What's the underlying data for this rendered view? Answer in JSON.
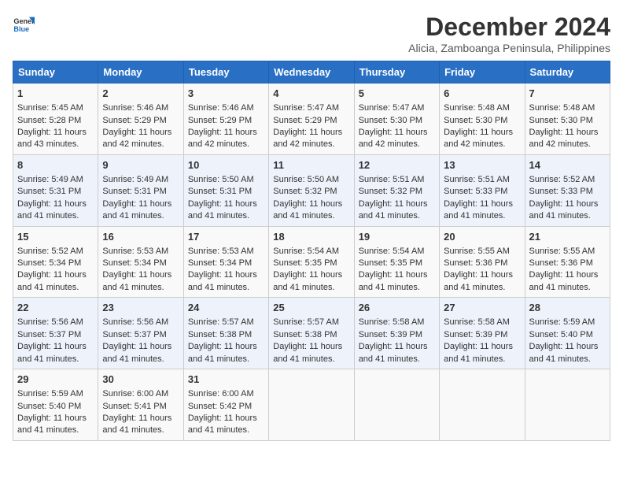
{
  "logo": {
    "line1": "General",
    "line2": "Blue"
  },
  "title": "December 2024",
  "subtitle": "Alicia, Zamboanga Peninsula, Philippines",
  "days_of_week": [
    "Sunday",
    "Monday",
    "Tuesday",
    "Wednesday",
    "Thursday",
    "Friday",
    "Saturday"
  ],
  "weeks": [
    [
      {
        "day": "1",
        "sunrise": "5:45 AM",
        "sunset": "5:28 PM",
        "daylight": "11 hours and 43 minutes."
      },
      {
        "day": "2",
        "sunrise": "5:46 AM",
        "sunset": "5:29 PM",
        "daylight": "11 hours and 42 minutes."
      },
      {
        "day": "3",
        "sunrise": "5:46 AM",
        "sunset": "5:29 PM",
        "daylight": "11 hours and 42 minutes."
      },
      {
        "day": "4",
        "sunrise": "5:47 AM",
        "sunset": "5:29 PM",
        "daylight": "11 hours and 42 minutes."
      },
      {
        "day": "5",
        "sunrise": "5:47 AM",
        "sunset": "5:30 PM",
        "daylight": "11 hours and 42 minutes."
      },
      {
        "day": "6",
        "sunrise": "5:48 AM",
        "sunset": "5:30 PM",
        "daylight": "11 hours and 42 minutes."
      },
      {
        "day": "7",
        "sunrise": "5:48 AM",
        "sunset": "5:30 PM",
        "daylight": "11 hours and 42 minutes."
      }
    ],
    [
      {
        "day": "8",
        "sunrise": "5:49 AM",
        "sunset": "5:31 PM",
        "daylight": "11 hours and 41 minutes."
      },
      {
        "day": "9",
        "sunrise": "5:49 AM",
        "sunset": "5:31 PM",
        "daylight": "11 hours and 41 minutes."
      },
      {
        "day": "10",
        "sunrise": "5:50 AM",
        "sunset": "5:31 PM",
        "daylight": "11 hours and 41 minutes."
      },
      {
        "day": "11",
        "sunrise": "5:50 AM",
        "sunset": "5:32 PM",
        "daylight": "11 hours and 41 minutes."
      },
      {
        "day": "12",
        "sunrise": "5:51 AM",
        "sunset": "5:32 PM",
        "daylight": "11 hours and 41 minutes."
      },
      {
        "day": "13",
        "sunrise": "5:51 AM",
        "sunset": "5:33 PM",
        "daylight": "11 hours and 41 minutes."
      },
      {
        "day": "14",
        "sunrise": "5:52 AM",
        "sunset": "5:33 PM",
        "daylight": "11 hours and 41 minutes."
      }
    ],
    [
      {
        "day": "15",
        "sunrise": "5:52 AM",
        "sunset": "5:34 PM",
        "daylight": "11 hours and 41 minutes."
      },
      {
        "day": "16",
        "sunrise": "5:53 AM",
        "sunset": "5:34 PM",
        "daylight": "11 hours and 41 minutes."
      },
      {
        "day": "17",
        "sunrise": "5:53 AM",
        "sunset": "5:34 PM",
        "daylight": "11 hours and 41 minutes."
      },
      {
        "day": "18",
        "sunrise": "5:54 AM",
        "sunset": "5:35 PM",
        "daylight": "11 hours and 41 minutes."
      },
      {
        "day": "19",
        "sunrise": "5:54 AM",
        "sunset": "5:35 PM",
        "daylight": "11 hours and 41 minutes."
      },
      {
        "day": "20",
        "sunrise": "5:55 AM",
        "sunset": "5:36 PM",
        "daylight": "11 hours and 41 minutes."
      },
      {
        "day": "21",
        "sunrise": "5:55 AM",
        "sunset": "5:36 PM",
        "daylight": "11 hours and 41 minutes."
      }
    ],
    [
      {
        "day": "22",
        "sunrise": "5:56 AM",
        "sunset": "5:37 PM",
        "daylight": "11 hours and 41 minutes."
      },
      {
        "day": "23",
        "sunrise": "5:56 AM",
        "sunset": "5:37 PM",
        "daylight": "11 hours and 41 minutes."
      },
      {
        "day": "24",
        "sunrise": "5:57 AM",
        "sunset": "5:38 PM",
        "daylight": "11 hours and 41 minutes."
      },
      {
        "day": "25",
        "sunrise": "5:57 AM",
        "sunset": "5:38 PM",
        "daylight": "11 hours and 41 minutes."
      },
      {
        "day": "26",
        "sunrise": "5:58 AM",
        "sunset": "5:39 PM",
        "daylight": "11 hours and 41 minutes."
      },
      {
        "day": "27",
        "sunrise": "5:58 AM",
        "sunset": "5:39 PM",
        "daylight": "11 hours and 41 minutes."
      },
      {
        "day": "28",
        "sunrise": "5:59 AM",
        "sunset": "5:40 PM",
        "daylight": "11 hours and 41 minutes."
      }
    ],
    [
      {
        "day": "29",
        "sunrise": "5:59 AM",
        "sunset": "5:40 PM",
        "daylight": "11 hours and 41 minutes."
      },
      {
        "day": "30",
        "sunrise": "6:00 AM",
        "sunset": "5:41 PM",
        "daylight": "11 hours and 41 minutes."
      },
      {
        "day": "31",
        "sunrise": "6:00 AM",
        "sunset": "5:42 PM",
        "daylight": "11 hours and 41 minutes."
      },
      null,
      null,
      null,
      null
    ]
  ],
  "labels": {
    "sunrise_prefix": "Sunrise: ",
    "sunset_prefix": "Sunset: ",
    "daylight_prefix": "Daylight: "
  }
}
